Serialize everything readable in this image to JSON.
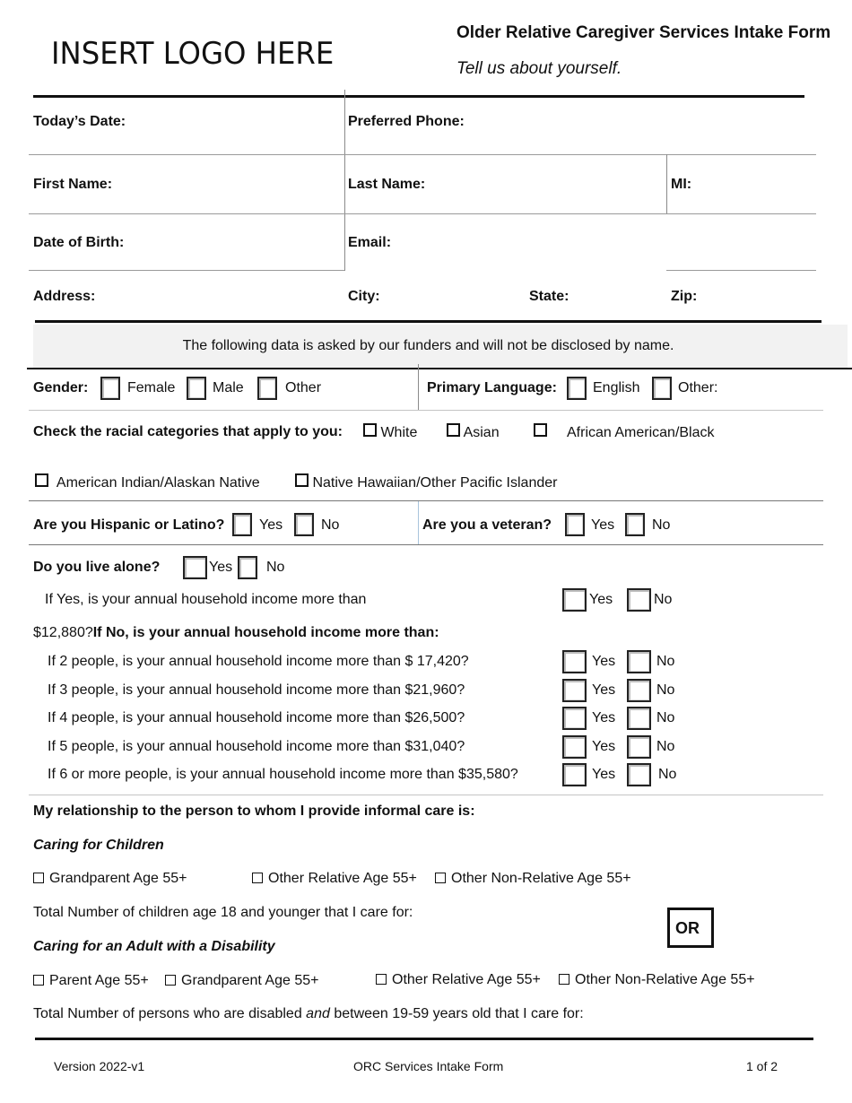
{
  "header": {
    "logo_placeholder": "INSERT LOGO HERE",
    "form_title": "Older Relative Caregiver Services Intake Form",
    "subtitle": "Tell us about yourself."
  },
  "personal_info": {
    "todays_date": "Today’s Date:",
    "preferred_phone": "Preferred Phone:",
    "first_name": "First Name:",
    "last_name": "Last Name:",
    "mi": "MI:",
    "date_of_birth": "Date of Birth:",
    "email": "Email:",
    "address": "Address:",
    "city": "City:",
    "state": "State:",
    "zip": "Zip:"
  },
  "funders_notice": "The following data is asked by our funders and will not be disclosed by name.",
  "demographics": {
    "gender_label": "Gender:",
    "gender_options": [
      "Female",
      "Male",
      "Other"
    ],
    "language_label": "Primary Language:",
    "language_options": [
      "English",
      "Other:"
    ],
    "race_label": "Check the racial categories that apply to you:",
    "race_options": [
      "White",
      "Asian",
      "African American/Black",
      "American Indian/Alaskan Native",
      "Native Hawaiian/Other Pacific Islander"
    ],
    "hispanic_label": "Are you Hispanic or Latino?",
    "veteran_label": "Are you a veteran?",
    "yes": "Yes",
    "no": "No"
  },
  "household": {
    "live_alone_label": "Do you live alone?",
    "if_yes_line1": "If Yes, is your annual household income more than",
    "if_yes_amount": "$12,880?",
    "if_no_label": "If No, is your annual household income more than:",
    "income_questions": [
      "If 2 people, is your annual household income more than $ 17,420?",
      "If 3 people, is your annual household income more than $21,960?",
      "If 4 people, is your annual household income more than $26,500?",
      "If 5 people, is your annual household income more than $31,040?",
      "If 6 or more people, is your annual household income more than $35,580?"
    ]
  },
  "relationship": {
    "heading": "My relationship to the person to whom I provide informal care is:",
    "children_heading": "Caring for Children",
    "children_options": [
      "Grandparent Age 55+",
      "Other Relative Age 55+",
      "Other Non-Relative Age 55+"
    ],
    "children_total": "Total Number of children age 18 and younger that I care for:",
    "or_label": "OR",
    "adult_heading": "Caring for an Adult with a Disability",
    "adult_options": [
      "Parent Age 55+",
      "Grandparent Age 55+",
      "Other Relative Age 55+",
      "Other Non-Relative Age 55+"
    ],
    "adult_total_pre": "Total Number of persons who are disabled ",
    "adult_total_em": "and",
    "adult_total_post": " between 19-59 years old that I care for:"
  },
  "footer": {
    "version": "Version 2022-v1",
    "form_name": "ORC Services Intake Form",
    "page": "1 of 2"
  }
}
